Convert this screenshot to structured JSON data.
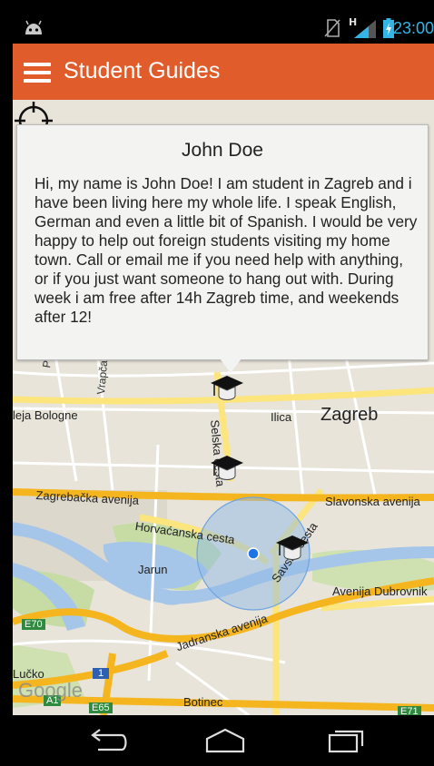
{
  "status_bar": {
    "time": "23:00",
    "network_type": "H",
    "icons": [
      "android-icon",
      "no-sim-icon",
      "signal-icon",
      "battery-charging-icon"
    ]
  },
  "app_bar": {
    "title": "Student Guides",
    "menu_icon": "hamburger-icon"
  },
  "info_window": {
    "name": "John Doe",
    "description": "Hi, my name is John Doe! I am student in Zagreb and i have been living here my whole life. I speak English, German and even a little bit of Spanish. I would be very happy to help out foreign students visiting my home town. Call or email me if you need help with anything, or if you just want someone to hang out with. During week i am free after 14h Zagreb time, and weekends after 12!"
  },
  "map": {
    "labels": {
      "city": "Zagreb",
      "perjavica": "Perjavica",
      "vrapcanska": "Vrapčanska",
      "bologne": "leja Bologne",
      "ilica": "Ilica",
      "selska": "Selska cesta",
      "zagrebacka": "Zagrebačka avenija",
      "slavonska": "Slavonska avenija",
      "horvacanska": "Horvaćanska cesta",
      "savska": "Savska cesta",
      "jarun": "Jarun",
      "dubrovnik": "Avenija Dubrovnik",
      "jadranska": "Jadranska avenija",
      "e70": "E70",
      "lucko": "Lučko",
      "a1": "A1",
      "route1": "1",
      "e65": "E65",
      "botinec": "Botinec",
      "e71": "E71",
      "google": "Google"
    },
    "marker_icon": "graduation-cap-icon",
    "colors": {
      "water": "#a6c6e9",
      "highway": "#f5b51e",
      "major_road": "#fce97d",
      "park": "#c6dca4",
      "accuracy_circle": "#8fb9e6"
    }
  },
  "nav_bar": {
    "back": "back-icon",
    "home": "home-icon",
    "recents": "recents-icon"
  },
  "colors": {
    "app_bar": "#e15c2b",
    "clock": "#33b5e5"
  }
}
